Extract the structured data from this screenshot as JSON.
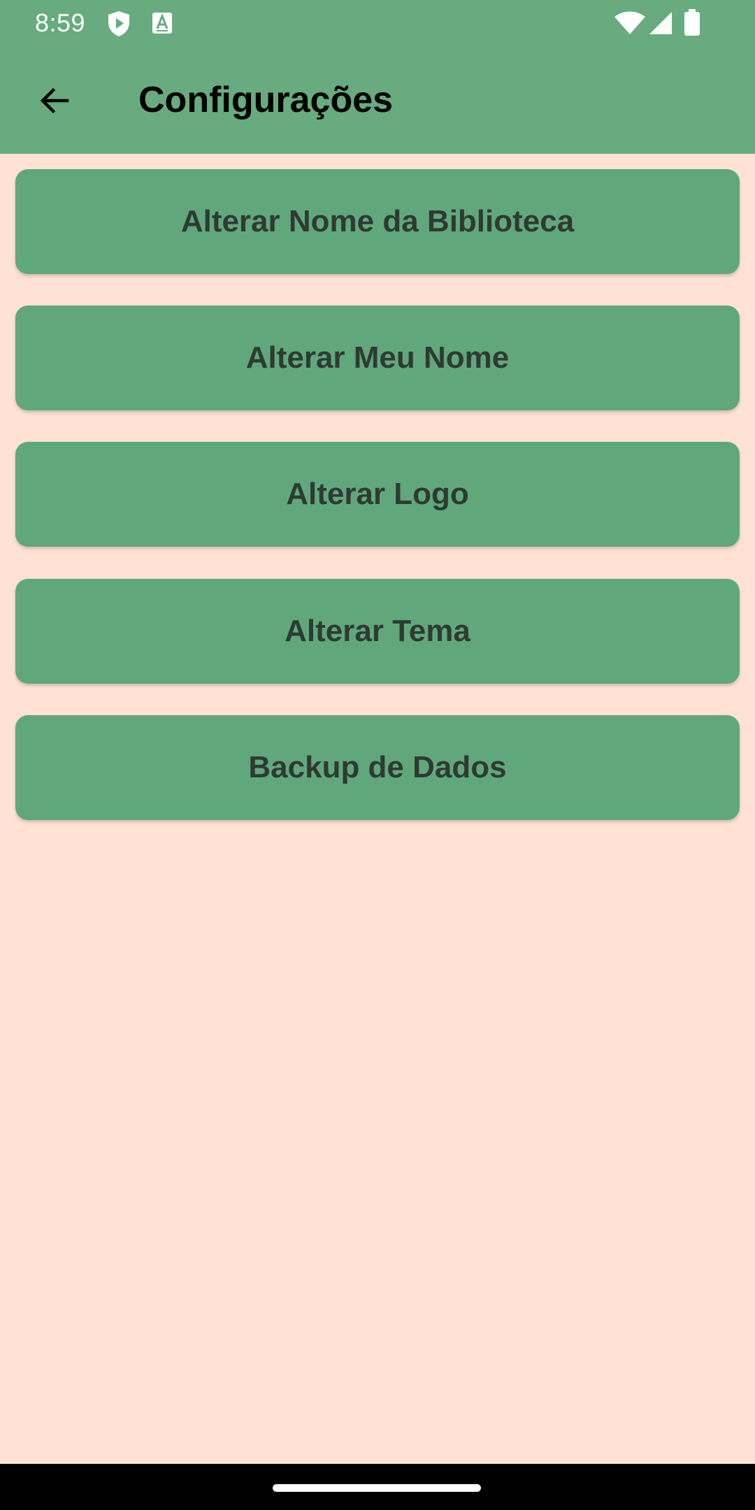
{
  "status_bar": {
    "time": "8:59",
    "left_icons": [
      "shield-play-icon",
      "text-a-icon"
    ],
    "right_icons": [
      "wifi-icon",
      "cellular-signal-icon",
      "battery-icon"
    ],
    "color": "#67AB7E"
  },
  "app_bar": {
    "back_icon": "arrow-back-icon",
    "title": "Configurações",
    "color": "#67AB7E"
  },
  "settings": {
    "items": [
      {
        "label": "Alterar Nome da Biblioteca"
      },
      {
        "label": "Alterar Meu Nome"
      },
      {
        "label": "Alterar Logo"
      },
      {
        "label": "Alterar Tema"
      },
      {
        "label": "Backup de Dados"
      }
    ],
    "button_color": "#60A87C",
    "background_color": "#FFE2D4"
  },
  "nav_bar": {
    "handle": "gesture-home-handle"
  }
}
